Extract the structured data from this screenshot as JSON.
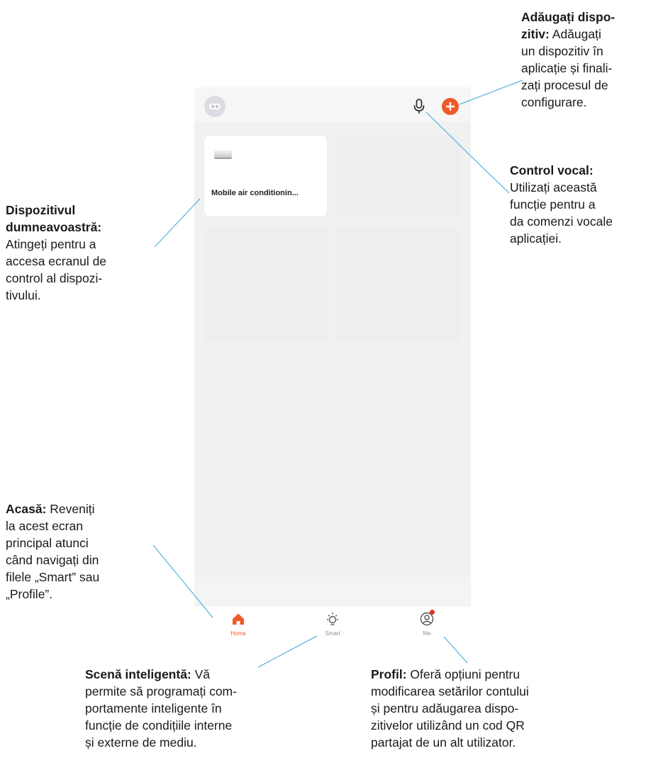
{
  "app": {
    "device": {
      "name": "Mobile air conditionin..."
    },
    "tabs": [
      {
        "label": "Home",
        "icon": "home-icon",
        "active": true
      },
      {
        "label": "Smart",
        "icon": "sun-icon",
        "active": false
      },
      {
        "label": "Me",
        "icon": "person-icon",
        "active": false,
        "badge": true
      }
    ],
    "colors": {
      "accent": "#f05a28",
      "badge": "#e8301c"
    }
  },
  "annotations": {
    "add_device": {
      "title": "Adăugați dispo-\nzitiv:",
      "title_l1": "Adăugați dispo-",
      "title_l2": "zitiv:",
      "text_l2": " Adăugați",
      "text_l3": "un dispozitiv în",
      "text_l4": "aplicație și finali-",
      "text_l5": "zați procesul de",
      "text_l6": "configurare."
    },
    "voice": {
      "title": "Control vocal:",
      "l1": "Utilizați această",
      "l2": "funcție pentru a",
      "l3": "da comenzi vocale",
      "l4": "aplicației."
    },
    "device": {
      "title_l1": "Dispozitivul",
      "title_l2": "dumneavoastră:",
      "l1": "Atingeți pentru a",
      "l2": "accesa ecranul de",
      "l3": "control al dispozi-",
      "l4": "tivului."
    },
    "home": {
      "title": "Acasă:",
      "l1": " Reveniți",
      "l2": "la acest ecran",
      "l3": "principal atunci",
      "l4": "când navigați din",
      "l5": "filele „Smart” sau",
      "l6": "„Profile”."
    },
    "scene": {
      "title": "Scenă inteligentă:",
      "l1": " Vă",
      "l2": "permite să programați com-",
      "l3": "portamente inteligente în",
      "l4": "funcție de condițiile interne",
      "l5": "și externe de mediu."
    },
    "profile": {
      "title": "Profil:",
      "l1": " Oferă opțiuni pentru",
      "l2": "modificarea setărilor contului",
      "l3": "și pentru adăugarea dispo-",
      "l4": "zitivelor utilizând un cod QR",
      "l5": "partajat de un alt utilizator."
    }
  }
}
